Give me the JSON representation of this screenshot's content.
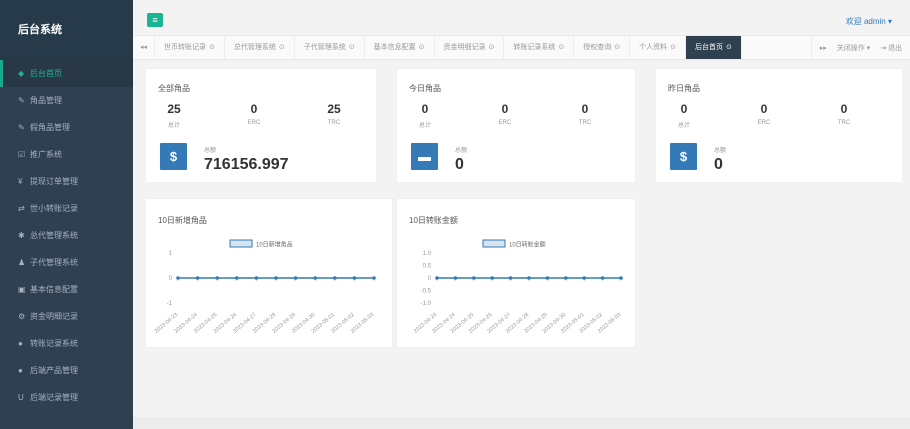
{
  "app": {
    "title": "后台系统"
  },
  "topbar": {
    "welcome": "欢迎 admin ▾",
    "menu_icon": "bars-icon"
  },
  "sidebar": {
    "items": [
      {
        "icon": "home-icon",
        "glyph": "◆",
        "label": "后台首页",
        "active": true
      },
      {
        "icon": "wrench-icon",
        "glyph": "✎",
        "label": "角品管理"
      },
      {
        "icon": "wrench-icon",
        "glyph": "✎",
        "label": "假角品管理"
      },
      {
        "icon": "share-icon",
        "glyph": "☑",
        "label": "推广系统"
      },
      {
        "icon": "withdraw-icon",
        "glyph": "¥",
        "label": "提现订单管理"
      },
      {
        "icon": "transfer-icon",
        "glyph": "⇄",
        "label": "世小转账记录"
      },
      {
        "icon": "gear-icon",
        "glyph": "✱",
        "label": "总代管理系统"
      },
      {
        "icon": "users-icon",
        "glyph": "♟",
        "label": "子代管理系统"
      },
      {
        "icon": "config-icon",
        "glyph": "▣",
        "label": "基本信息配置"
      },
      {
        "icon": "settings-icon",
        "glyph": "⚙",
        "label": "资金明细记录"
      },
      {
        "icon": "record-icon",
        "glyph": "●",
        "label": "转账记录系统"
      },
      {
        "icon": "chat-icon",
        "glyph": "●",
        "label": "后端产品管理"
      },
      {
        "icon": "magnet-icon",
        "glyph": "U",
        "label": "后端记录管理"
      }
    ]
  },
  "tabs": {
    "items": [
      {
        "label": "世币转账记录",
        "active": false
      },
      {
        "label": "总代管理系统",
        "active": false
      },
      {
        "label": "子代管理系统",
        "active": false
      },
      {
        "label": "基本信息配置",
        "active": false
      },
      {
        "label": "资金明细记录",
        "active": false
      },
      {
        "label": "转账记录系统",
        "active": false
      },
      {
        "label": "授权查询",
        "active": false
      },
      {
        "label": "个人资料",
        "active": false
      },
      {
        "label": "后台首页",
        "active": true
      }
    ],
    "close_glyph": "⊙",
    "left_nav": "◂◂",
    "right_nav": "▸▸",
    "close_ops": "关闭操作 ▾",
    "logout": "⇥ 退出"
  },
  "cards": [
    {
      "title": "全部角品",
      "stats": [
        {
          "num": "25",
          "lbl": "总计"
        },
        {
          "num": "0",
          "lbl": "ERC"
        },
        {
          "num": "25",
          "lbl": "TRC"
        }
      ],
      "icon": "dollar-icon",
      "glyph": "$",
      "big_label": "总额",
      "big_value": "716156.997"
    },
    {
      "title": "今日角品",
      "stats": [
        {
          "num": "0",
          "lbl": "总计"
        },
        {
          "num": "0",
          "lbl": "ERC"
        },
        {
          "num": "0",
          "lbl": "TRC"
        }
      ],
      "icon": "archive-icon",
      "glyph": "▬",
      "big_label": "总额",
      "big_value": "0"
    },
    {
      "title": "昨日角品",
      "stats": [
        {
          "num": "0",
          "lbl": "总计"
        },
        {
          "num": "0",
          "lbl": "ERC"
        },
        {
          "num": "0",
          "lbl": "TRC"
        }
      ],
      "icon": "dollar-icon",
      "glyph": "$",
      "big_label": "总额",
      "big_value": "0"
    }
  ],
  "colors": {
    "accent": "#1ab394",
    "brand": "#2f4050",
    "primary": "#337ab7",
    "line": "#337ab7"
  },
  "chart_data": [
    {
      "type": "line",
      "title": "10日新增角品",
      "x": [
        "2023-04-23",
        "2023-04-24",
        "2023-04-25",
        "2023-04-26",
        "2023-04-27",
        "2023-04-28",
        "2023-04-29",
        "2023-04-30",
        "2023-05-01",
        "2023-05-02",
        "2023-05-03"
      ],
      "y_ticks": [
        "1",
        "0",
        "-1"
      ],
      "ylim": [
        -1,
        1
      ],
      "series": [
        {
          "name": "10日新增角品",
          "values": [
            0,
            0,
            0,
            0,
            0,
            0,
            0,
            0,
            0,
            0,
            0
          ]
        }
      ],
      "legend": "top-center"
    },
    {
      "type": "line",
      "title": "10日转账金额",
      "x": [
        "2023-04-23",
        "2023-04-24",
        "2023-04-25",
        "2023-04-26",
        "2023-04-27",
        "2023-04-28",
        "2023-04-29",
        "2023-04-30",
        "2023-05-01",
        "2023-05-02",
        "2023-05-03"
      ],
      "y_ticks": [
        "1.0",
        "0.5",
        "0",
        "-0.5",
        "-1.0"
      ],
      "ylim": [
        -1,
        1
      ],
      "series": [
        {
          "name": "10日转账金额",
          "values": [
            0,
            0,
            0,
            0,
            0,
            0,
            0,
            0,
            0,
            0,
            0
          ]
        }
      ],
      "legend": "top-center"
    }
  ]
}
